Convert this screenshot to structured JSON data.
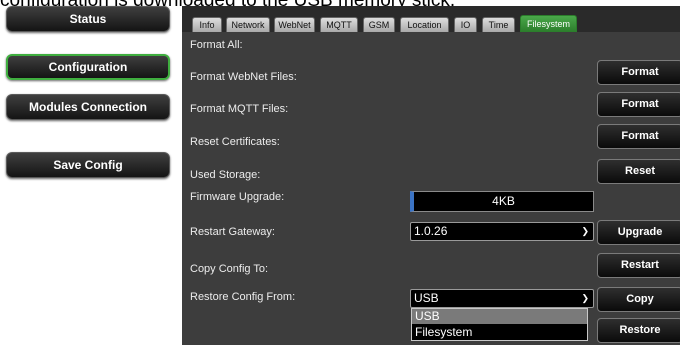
{
  "caption": "configuration is downloaded to the USB memory stick.",
  "sidebar": {
    "items": [
      {
        "label": "Status"
      },
      {
        "label": "Configuration"
      },
      {
        "label": "Modules Connection"
      },
      {
        "label": "Save Config"
      }
    ]
  },
  "tabs": [
    {
      "label": "Info"
    },
    {
      "label": "Network"
    },
    {
      "label": "WebNet"
    },
    {
      "label": "MQTT"
    },
    {
      "label": "GSM"
    },
    {
      "label": "Location"
    },
    {
      "label": "IO"
    },
    {
      "label": "Time"
    },
    {
      "label": "Filesystem"
    }
  ],
  "active_tab": "Filesystem",
  "rows": {
    "format_all": {
      "label": "Format All:",
      "button": "Format"
    },
    "format_webnet": {
      "label": "Format WebNet Files:",
      "button": "Format"
    },
    "format_mqtt": {
      "label": "Format MQTT Files:",
      "button": "Format"
    },
    "reset_certs": {
      "label": "Reset Certificates:",
      "button": "Reset"
    },
    "used_storage": {
      "label": "Used Storage:",
      "value": "4KB"
    },
    "firmware_upgrade": {
      "label": "Firmware Upgrade:",
      "value": "1.0.26",
      "button": "Upgrade"
    },
    "restart_gateway": {
      "label": "Restart Gateway:",
      "button": "Restart"
    },
    "copy_config": {
      "label": "Copy Config To:",
      "value": "USB",
      "button": "Copy"
    },
    "restore_config": {
      "label": "Restore Config From:",
      "button": "Restore"
    }
  },
  "copy_dropdown": {
    "options": [
      "USB",
      "Filesystem"
    ],
    "highlighted": "USB"
  },
  "colors": {
    "accent_green": "#3fae3f",
    "panel_bg": "#3d3d3d",
    "tabbar_bg": "#2a2a2a",
    "focus_blue": "#3b73c4"
  }
}
